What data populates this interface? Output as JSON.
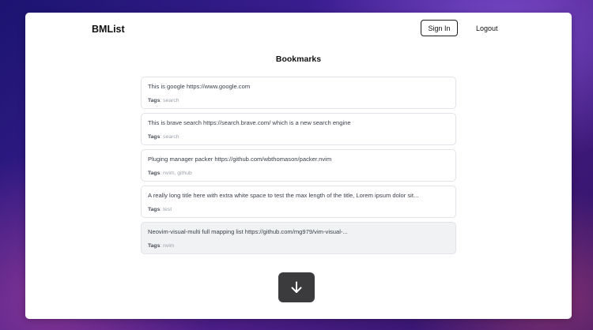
{
  "header": {
    "brand": "BMList",
    "sign_in_label": "Sign In",
    "logout_label": "Logout"
  },
  "main": {
    "title": "Bookmarks",
    "tags_label": "Tags",
    "bookmarks": [
      {
        "title": "This is google https://www.google.com",
        "tags": "search"
      },
      {
        "title": "This is brave search https://search.brave.com/ which is a new search engine",
        "tags": "search"
      },
      {
        "title": "Pluging manager packer https://github.com/wbthomason/packer.nvim",
        "tags": "nvim, github"
      },
      {
        "title": "A really long title here with extra white space to test the max length of the title, Lorem ipsum dolor sit...",
        "tags": "test"
      },
      {
        "title": "Neovim-visual-multi full mapping list https://github.com/mg979/vim-visual-...",
        "tags": "nvim"
      }
    ]
  },
  "scroll_button": {
    "icon": "arrow-down-icon"
  },
  "colors": {
    "card_border": "#e1e3e8",
    "card_hover_bg": "#f1f2f4",
    "scroll_button_bg": "#3b3b3e"
  }
}
